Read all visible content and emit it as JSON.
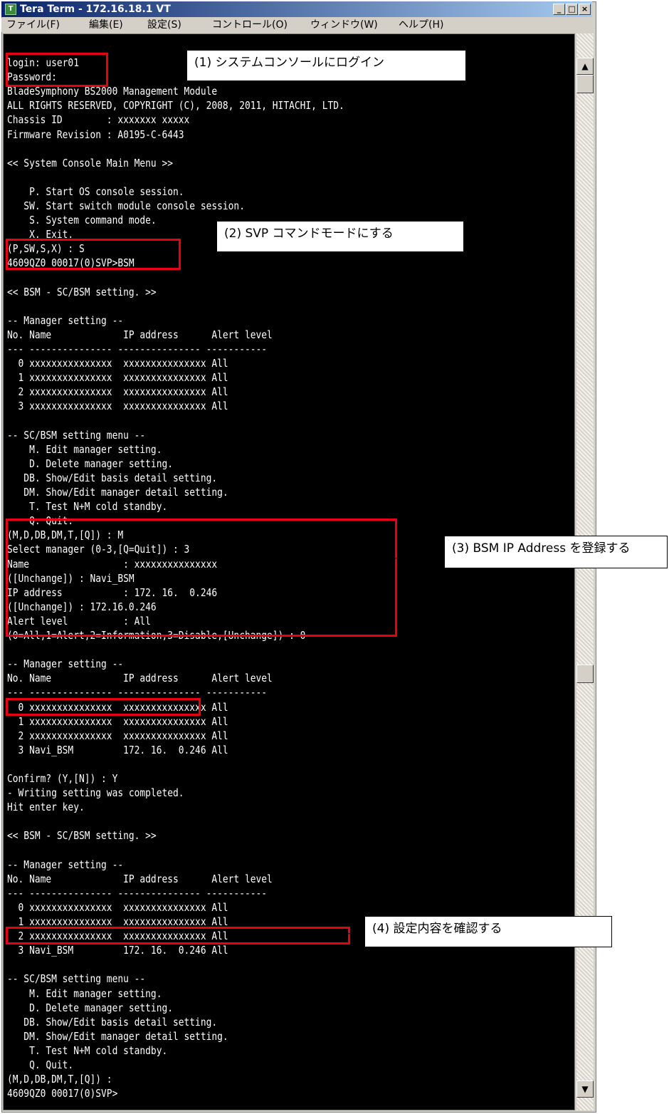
{
  "window": {
    "title": "Tera Term - 172.16.18.1 VT",
    "app_icon": "tera-term-icon",
    "controls": [
      "minimize-icon",
      "maximize-icon",
      "close-icon"
    ]
  },
  "menu": [
    {
      "label": "ファイル(F)"
    },
    {
      "label": "編集(E)"
    },
    {
      "label": "設定(S)"
    },
    {
      "label": "コントロール(O)"
    },
    {
      "label": "ウィンドウ(W)"
    },
    {
      "label": "ヘルプ(H)"
    }
  ],
  "terminal_lines": [
    "login: user01",
    "Password:",
    "BladeSymphony BS2000 Management Module",
    "ALL RIGHTS RESERVED, COPYRIGHT (C), 2008, 2011, HITACHI, LTD.",
    "Chassis ID        : xxxxxxx xxxxx",
    "Firmware Revision : A0195-C-6443",
    "",
    "<< System Console Main Menu >>",
    "",
    "    P. Start OS console session.",
    "   SW. Start switch module console session.",
    "    S. System command mode.",
    "    X. Exit.",
    "(P,SW,S,X) : S",
    "4609QZ0 00017(0)SVP>BSM",
    "",
    "<< BSM - SC/BSM setting. >>",
    "",
    "-- Manager setting --",
    "No. Name             IP address      Alert level",
    "--- --------------- --------------- -----------",
    "  0 xxxxxxxxxxxxxxx  xxxxxxxxxxxxxxx All",
    "  1 xxxxxxxxxxxxxxx  xxxxxxxxxxxxxxx All",
    "  2 xxxxxxxxxxxxxxx  xxxxxxxxxxxxxxx All",
    "  3 xxxxxxxxxxxxxxx  xxxxxxxxxxxxxxx All",
    "",
    "-- SC/BSM setting menu --",
    "    M. Edit manager setting.",
    "    D. Delete manager setting.",
    "   DB. Show/Edit basis detail setting.",
    "   DM. Show/Edit manager detail setting.",
    "    T. Test N+M cold standby.",
    "    Q. Quit.",
    "(M,D,DB,DM,T,[Q]) : M",
    "Select manager (0-3,[Q=Quit]) : 3",
    "Name                 : xxxxxxxxxxxxxxx",
    "([Unchange]) : Navi_BSM",
    "IP address           : 172. 16.  0.246",
    "([Unchange]) : 172.16.0.246",
    "Alert level          : All",
    "(0=All,1=Alert,2=Information,3=Disable,[Unchange]) : 0",
    "",
    "-- Manager setting --",
    "No. Name             IP address      Alert level",
    "--- --------------- --------------- -----------",
    "  0 xxxxxxxxxxxxxxx  xxxxxxxxxxxxxxx All",
    "  1 xxxxxxxxxxxxxxx  xxxxxxxxxxxxxxx All",
    "  2 xxxxxxxxxxxxxxx  xxxxxxxxxxxxxxx All",
    "  3 Navi_BSM         172. 16.  0.246 All",
    "",
    "Confirm? (Y,[N]) : Y",
    "- Writing setting was completed.",
    "Hit enter key.",
    "",
    "<< BSM - SC/BSM setting. >>",
    "",
    "-- Manager setting --",
    "No. Name             IP address      Alert level",
    "--- --------------- --------------- -----------",
    "  0 xxxxxxxxxxxxxxx  xxxxxxxxxxxxxxx All",
    "  1 xxxxxxxxxxxxxxx  xxxxxxxxxxxxxxx All",
    "  2 xxxxxxxxxxxxxxx  xxxxxxxxxxxxxxx All",
    "  3 Navi_BSM         172. 16.  0.246 All",
    "",
    "-- SC/BSM setting menu --",
    "    M. Edit manager setting.",
    "    D. Delete manager setting.",
    "   DB. Show/Edit basis detail setting.",
    "   DM. Show/Edit manager detail setting.",
    "    T. Test N+M cold standby.",
    "    Q. Quit.",
    "(M,D,DB,DM,T,[Q]) :",
    "4609QZ0 00017(0)SVP>"
  ],
  "callouts": [
    {
      "label": "(1) システムコンソールにログイン"
    },
    {
      "label": "(2) SVP コマンドモードにする"
    },
    {
      "label": "(3) BSM IP Address を登録する"
    },
    {
      "label": "(4) 設定内容を確認する"
    }
  ],
  "scrollbar": {
    "up_icon": "scroll-up-arrow-icon",
    "down_icon": "scroll-down-arrow-icon"
  },
  "colors": {
    "terminal_bg": "#000000",
    "terminal_fg": "#ffffff",
    "highlight": "#e60012",
    "titlebar_start": "#0a246a",
    "titlebar_end": "#a6caf0"
  }
}
